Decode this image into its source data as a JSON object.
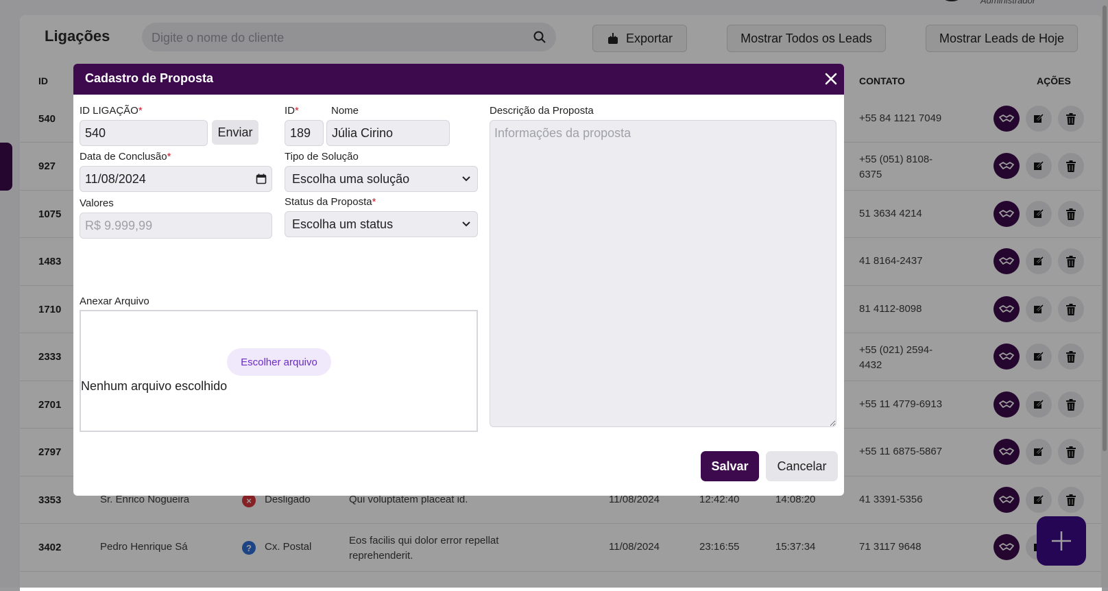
{
  "header": {
    "role_text": "Administrador",
    "page_title": "Ligações",
    "search_placeholder": "Digite o nome do cliente",
    "export_label": "Exportar",
    "show_all_label": "Mostrar Todos os Leads",
    "show_today_label": "Mostrar Leads de Hoje"
  },
  "table": {
    "headers": {
      "id": "ID",
      "contato": "CONTATO",
      "acoes": "AÇÕES"
    },
    "rows": [
      {
        "id": "540",
        "contato": "+55 84 1121 7049"
      },
      {
        "id": "927",
        "contato": "+55 (051) 8108-6375"
      },
      {
        "id": "1075",
        "contato": "51 3634 4214"
      },
      {
        "id": "1483",
        "contato": "41 8164-2437"
      },
      {
        "id": "1710",
        "contato": "81 4112-8098"
      },
      {
        "id": "2333",
        "contato": "+55 (021) 2594-4432"
      },
      {
        "id": "2701",
        "contato": "+55 11 4779-6913"
      },
      {
        "id": "2797",
        "contato": "+55 11 6875-5867"
      },
      {
        "id": "3353",
        "nome": "Sr. Enrico Nogueira",
        "status": "Desligado",
        "descricao": "Qui voluptatem placeat id.",
        "data": "11/08/2024",
        "inicio": "12:42:40",
        "fim": "14:08:20",
        "contato": "41 3391-5356"
      },
      {
        "id": "3402",
        "nome": "Pedro Henrique Sá",
        "status": "Cx. Postal",
        "descricao": "Eos facilis qui dolor error repellat reprehenderit.",
        "data": "11/08/2024",
        "inicio": "23:16:55",
        "fim": "15:37:34",
        "contato": "71 3117 9648"
      }
    ]
  },
  "modal": {
    "title": "Cadastro de Proposta",
    "id_ligacao_label": "ID LIGAÇÃO",
    "id_ligacao_value": "540",
    "enviar_label": "Enviar",
    "id_label": "ID",
    "id_value": "189",
    "nome_label": "Nome",
    "nome_value": "Júlia Cirino",
    "data_conclusao_label": "Data de Conclusão",
    "data_conclusao_value": "11/08/2024",
    "tipo_solucao_label": "Tipo de Solução",
    "tipo_solucao_value": "Escolha uma solução",
    "valores_label": "Valores",
    "valores_placeholder": "R$ 9.999,99",
    "status_label": "Status da Proposta",
    "status_value": "Escolha um status",
    "descricao_label": "Descrição da Proposta",
    "descricao_placeholder": "Informações da proposta",
    "anexar_label": "Anexar Arquivo",
    "escolher_arquivo_label": "Escolher arquivo",
    "nenhum_arquivo_label": "Nenhum arquivo escolhido",
    "salvar_label": "Salvar",
    "cancelar_label": "Cancelar",
    "required_mark": "*"
  },
  "colors": {
    "brand": "#3d0a4d",
    "accent": "#3d0a8a",
    "required": "#d11a2a"
  }
}
